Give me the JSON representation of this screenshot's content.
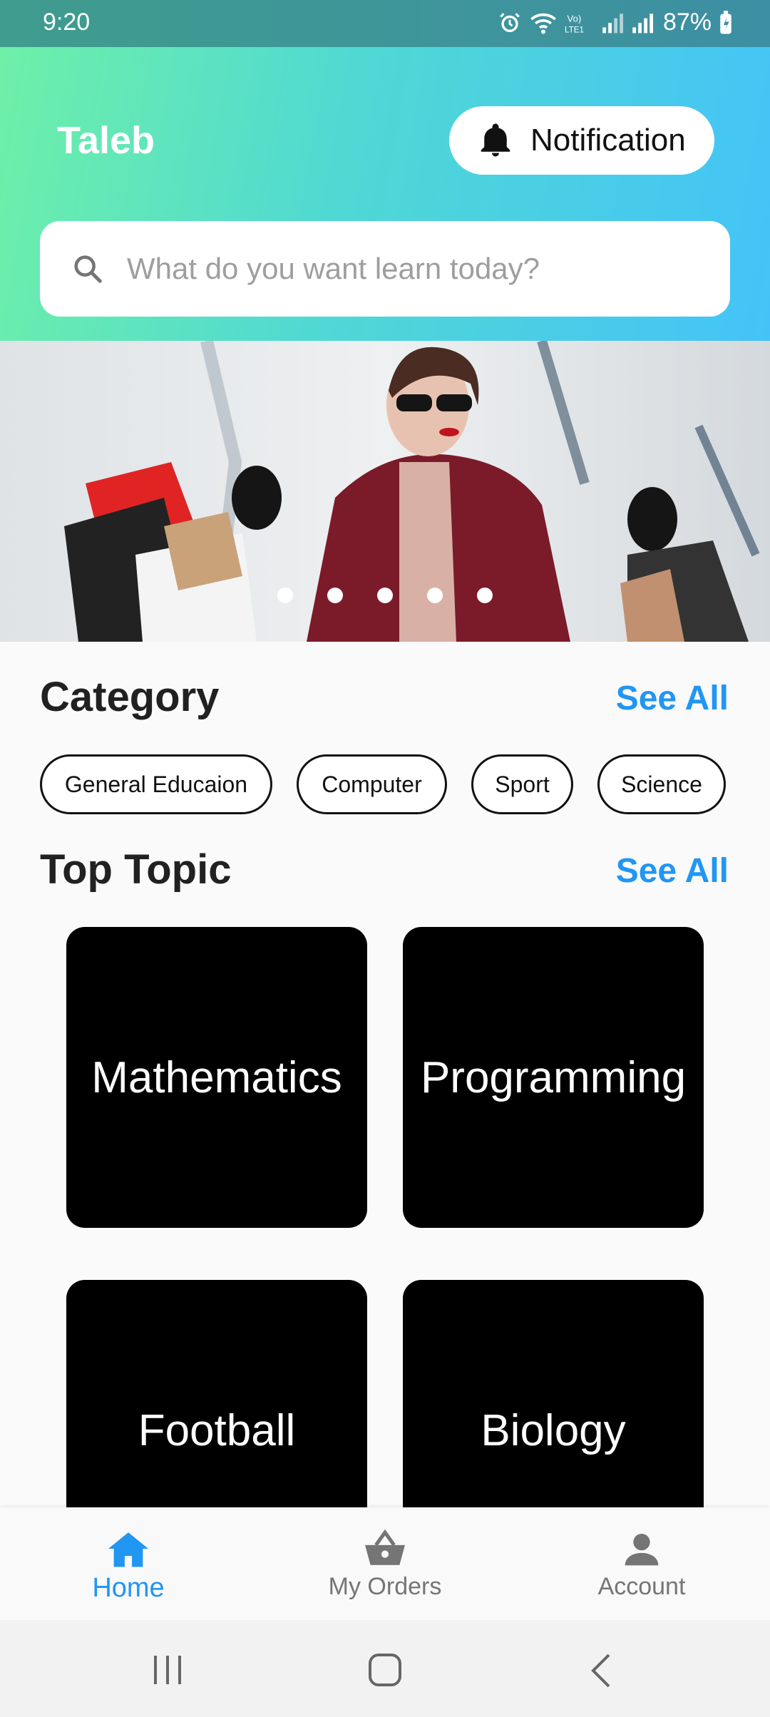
{
  "status_bar": {
    "time": "9:20",
    "battery": "87%"
  },
  "header": {
    "app_title": "Taleb",
    "notification_label": "Notification",
    "search_placeholder": "What do you want learn today?"
  },
  "banner": {
    "dot_count": 5
  },
  "category": {
    "title": "Category",
    "see_all": "See All",
    "chips": [
      "General Educaion",
      "Computer",
      "Sport",
      "Science"
    ]
  },
  "top_topic": {
    "title": "Top Topic",
    "see_all": "See All",
    "topics": [
      "Mathematics",
      "Programming",
      "Football",
      "Biology"
    ]
  },
  "bottom_nav": {
    "items": [
      {
        "label": "Home",
        "icon": "home-icon",
        "active": true
      },
      {
        "label": "My Orders",
        "icon": "basket-icon",
        "active": false
      },
      {
        "label": "Account",
        "icon": "person-icon",
        "active": false
      }
    ]
  },
  "colors": {
    "accent": "#2196f3",
    "card": "#000000",
    "header_start": "#6ef0a8",
    "header_end": "#44c3f8"
  }
}
